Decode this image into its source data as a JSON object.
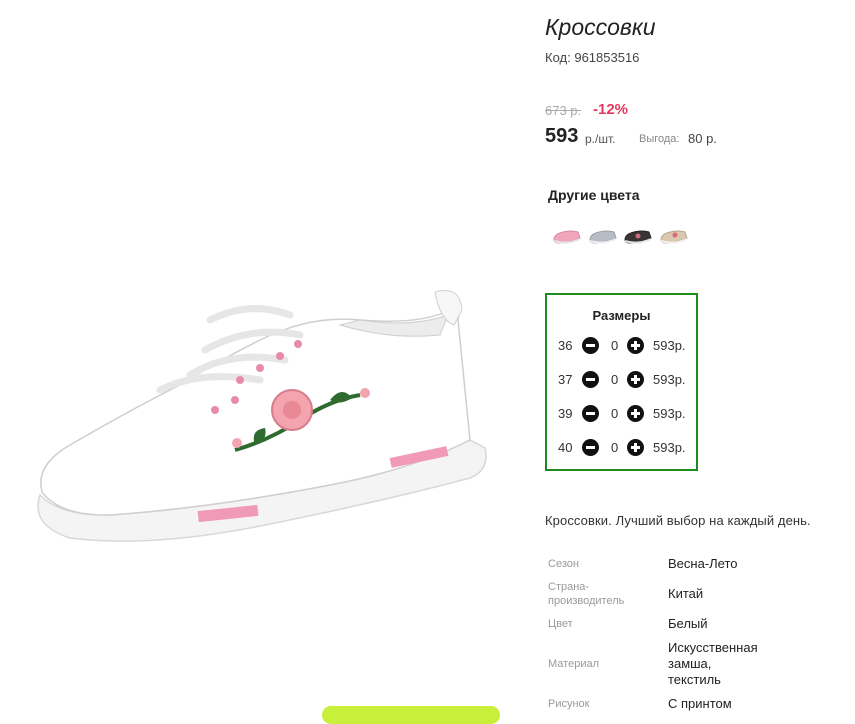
{
  "product": {
    "title": "Кроссовки",
    "code_label": "Код:",
    "code": "961853516"
  },
  "pricing": {
    "old_price": "673 р.",
    "discount": "-12%",
    "price": "593",
    "price_unit": "р./шт.",
    "savings_label": "Выгода:",
    "savings_value": "80 р."
  },
  "other_colors": {
    "title": "Другие цвета",
    "swatches": [
      {
        "icon": "pink-sneaker-icon",
        "color": "#f2a6bd"
      },
      {
        "icon": "grey-sneaker-icon",
        "color": "#b8bcc6"
      },
      {
        "icon": "black-sneaker-icon",
        "color": "#3a3434"
      },
      {
        "icon": "beige-sneaker-icon",
        "color": "#d9c7b0"
      }
    ]
  },
  "sizes": {
    "title": "Размеры",
    "rows": [
      {
        "size": "36",
        "qty": "0",
        "price": "593р."
      },
      {
        "size": "37",
        "qty": "0",
        "price": "593р."
      },
      {
        "size": "39",
        "qty": "0",
        "price": "593р."
      },
      {
        "size": "40",
        "qty": "0",
        "price": "593р."
      }
    ]
  },
  "description": "Кроссовки. Лучший выбор на каждый день.",
  "specs": [
    {
      "label": "Сезон",
      "value": "Весна-Лето"
    },
    {
      "label": "Страна-\nпроизводитель",
      "value": "Китай"
    },
    {
      "label": "Цвет",
      "value": "Белый"
    },
    {
      "label": "Материал",
      "value": "Искусственная\nзамша,\nтекстиль"
    },
    {
      "label": "Рисунок",
      "value": "С принтом"
    }
  ],
  "colors": {
    "accent_green": "#1d8a1d",
    "discount_red": "#e8375e",
    "cta_green": "#c8ef3a"
  }
}
